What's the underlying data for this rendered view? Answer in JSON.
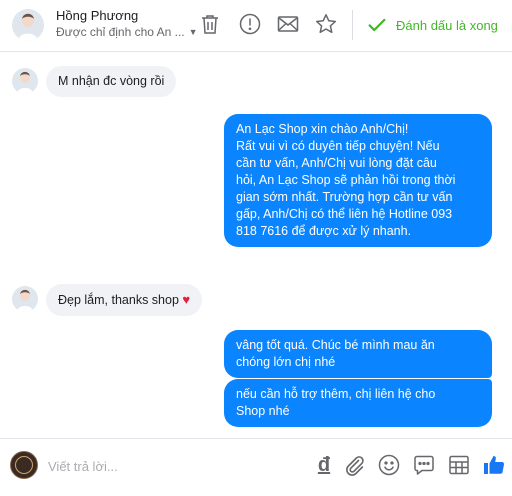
{
  "header": {
    "contact_name": "Hồng Phương",
    "assigned_to": "Được chỉ định cho An ...",
    "mark_done_label": "Đánh dấu là xong",
    "icons": [
      "trash-icon",
      "spam-icon",
      "mail-icon",
      "star-icon",
      "check-icon"
    ]
  },
  "messages": [
    {
      "direction": "incoming",
      "text": "M nhận đc vòng rồi"
    },
    {
      "direction": "outgoing",
      "lines": [
        "An Lạc Shop xin chào Anh/Chị!",
        "Rất vui vì có duyên tiếp chuyện! Nếu",
        "cần tư vấn, Anh/Chị vui lòng đặt câu",
        "hỏi, An Lạc Shop sẽ phản hồi trong thời",
        "gian sớm nhất. Trường hợp cần tư vấn",
        "gấp, Anh/Chị có thể liên hệ Hotline 093",
        "818 7616 để được xử lý nhanh."
      ]
    },
    {
      "direction": "incoming",
      "text": "Đẹp lắm, thanks shop",
      "emoji": "♥"
    },
    {
      "direction": "outgoing",
      "lines": [
        "vâng tốt quá. Chúc bé mình mau ăn",
        "chóng lớn chị nhé"
      ]
    },
    {
      "direction": "outgoing",
      "lines": [
        "nếu cần hỗ trợ thêm, chị liên hệ cho",
        "Shop nhé"
      ]
    }
  ],
  "composer": {
    "placeholder": "Viết trả lời...",
    "icons": [
      "currency-dong-icon",
      "attachment-icon",
      "emoji-icon",
      "saved-replies-icon",
      "template-icon",
      "like-icon"
    ],
    "currency_symbol": "đ"
  },
  "colors": {
    "outgoing_bubble": "#0a84ff",
    "incoming_bubble": "#f0f2f5",
    "done_green": "#42b72a",
    "like_blue": "#1877f2"
  }
}
